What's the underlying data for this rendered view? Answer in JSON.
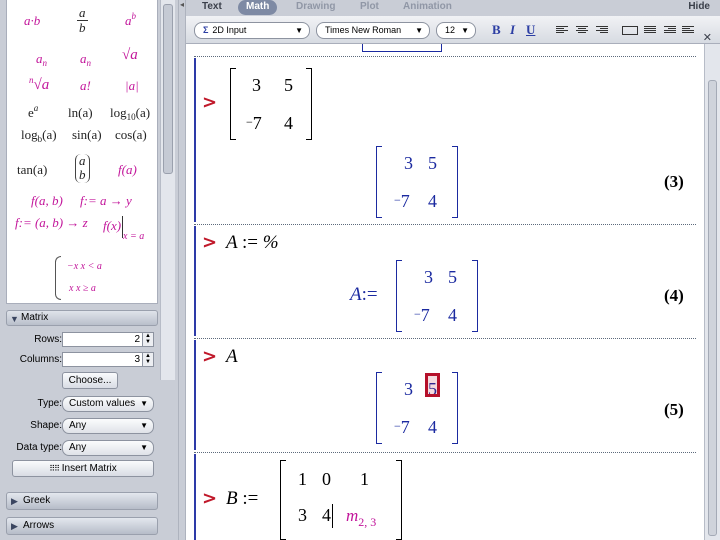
{
  "tabs": [
    {
      "label": "Text",
      "state": "normal"
    },
    {
      "label": "Math",
      "state": "active"
    },
    {
      "label": "Drawing",
      "state": "dim"
    },
    {
      "label": "Plot",
      "state": "dim"
    },
    {
      "label": "Animation",
      "state": "dim"
    }
  ],
  "toolbar": {
    "input_mode": "2D Input",
    "font_family": "Times New Roman",
    "font_size": "12",
    "bold": "B",
    "italic": "I",
    "underline": "U",
    "hide_label": "Hide",
    "close_glyph": "✕"
  },
  "palette": {
    "expressions": {
      "a_dot_b": "a·b",
      "frac_num": "a",
      "frac_den": "b",
      "pow_base": "a",
      "pow_exp": "b",
      "sub1_base": "a",
      "sub1_idx": "n",
      "sub2_base": "a",
      "sub2_idx": "n",
      "sqrt": "√a",
      "nroot_idx": "n",
      "nroot_body": "√a",
      "factorial": "a!",
      "abs": "|a|",
      "exp_base": "e",
      "exp_pow": "a",
      "ln": "ln(a)",
      "log10_fn": "log",
      "log10_sub": "10",
      "log10_arg": "(a)",
      "logb_fn": "log",
      "logb_sub": "b",
      "logb_arg": "(a)",
      "sin": "sin(a)",
      "cos": "cos(a)",
      "tan": "tan(a)",
      "binom_top": "a",
      "binom_bottom": "b",
      "f_of_a": "f(a)",
      "f_of_ab": "f(a, b)",
      "arrow_map": "f:= a → y",
      "multi_map": "f:= (a, b) → z",
      "eval_at_f": "f(x)",
      "eval_at_cond": "x = a",
      "piece_1": "−x   x < a",
      "piece_2": "x    x ≥ a"
    }
  },
  "matrix_panel": {
    "title": "Matrix",
    "rows_label": "Rows:",
    "rows_value": "2",
    "columns_label": "Columns:",
    "columns_value": "3",
    "choose_label": "Choose...",
    "type_label": "Type:",
    "type_value": "Custom values",
    "shape_label": "Shape:",
    "shape_value": "Any",
    "datatype_label": "Data type:",
    "datatype_value": "Any",
    "insert_label": "Insert Matrix"
  },
  "collapsed_palettes": [
    "Greek",
    "Arrows"
  ],
  "worksheet": {
    "prompt": ">",
    "input1": {
      "m11": "3",
      "m12": "5",
      "m21": "7",
      "m22": "4",
      "neg": "−"
    },
    "output1": {
      "m11": "3",
      "m12": "5",
      "m21": "7",
      "m22": "4",
      "neg": "−",
      "label": "(3)"
    },
    "input2": {
      "lhs": "A",
      "assign": ":=",
      "rhs": "%"
    },
    "output2": {
      "lhs": "A",
      "assign": ":=",
      "m11": "3",
      "m12": "5",
      "m21": "7",
      "m22": "4",
      "neg": "−",
      "label": "(4)"
    },
    "input3": {
      "text": "A"
    },
    "output3": {
      "m11": "3",
      "m12": "5",
      "m21": "7",
      "m22": "4",
      "neg": "−",
      "label": "(5)"
    },
    "input4": {
      "lhs": "B",
      "assign": ":=",
      "m11": "1",
      "m12": "0",
      "m13": "1",
      "m21": "3",
      "m22": "4",
      "m23_base": "m",
      "m23_sub": "2, 3"
    }
  }
}
